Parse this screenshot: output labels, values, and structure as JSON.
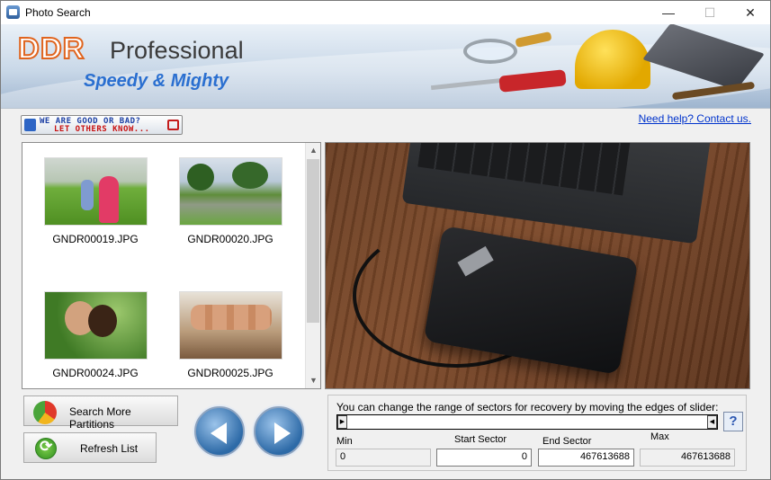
{
  "window": {
    "title": "Photo Search",
    "controls": {
      "minimize": "—",
      "maximize": "☐",
      "close": "✕"
    }
  },
  "banner": {
    "brand": "DDR",
    "product": "Professional",
    "tagline": "Speedy & Mighty"
  },
  "feedback": {
    "line1": "WE ARE GOOD OR BAD?",
    "line2": "LET OTHERS KNOW..."
  },
  "help_link": "Need help? Contact us.",
  "thumbnails": [
    {
      "filename": "GNDR00019.JPG"
    },
    {
      "filename": "GNDR00020.JPG"
    },
    {
      "filename": "GNDR00024.JPG"
    },
    {
      "filename": "GNDR00025.JPG"
    }
  ],
  "buttons": {
    "search_more": "Search More Partitions",
    "refresh": "Refresh List"
  },
  "sector": {
    "hint": "You can change the range of sectors for recovery by moving the edges of slider:",
    "help_glyph": "?",
    "min_label": "Min",
    "start_label": "Start Sector",
    "end_label": "End Sector",
    "max_label": "Max",
    "min_value": "0",
    "start_value": "0",
    "end_value": "467613688",
    "max_value": "467613688"
  },
  "colors": {
    "accent": "#2a6fd0",
    "brand_orange": "#e0641e",
    "link": "#0033cc"
  }
}
